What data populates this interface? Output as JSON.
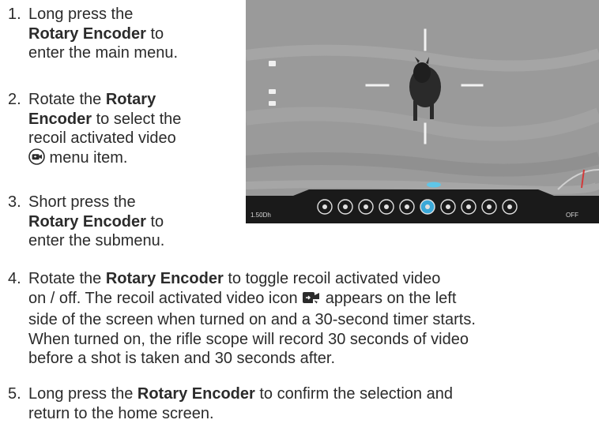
{
  "steps": [
    {
      "number": "1.",
      "lines": [
        {
          "parts": [
            "Long press the"
          ]
        },
        {
          "parts": [
            "",
            "Rotary Encoder",
            " to"
          ]
        },
        {
          "parts": [
            "enter the main menu."
          ]
        }
      ]
    },
    {
      "number": "2.",
      "lines": [
        {
          "parts": [
            "Rotate the ",
            "Rotary"
          ]
        },
        {
          "parts": [
            "",
            "Encoder",
            " to select the"
          ]
        },
        {
          "parts": [
            "recoil activated video"
          ]
        },
        {
          "parts": [
            " menu item."
          ]
        }
      ]
    },
    {
      "number": "3.",
      "lines": [
        {
          "parts": [
            "Short press the"
          ]
        },
        {
          "parts": [
            "",
            "Rotary Encoder",
            " to"
          ]
        },
        {
          "parts": [
            "enter the submenu."
          ]
        }
      ]
    },
    {
      "number": "4.",
      "lines": [
        {
          "parts": [
            "Rotate the ",
            "Rotary Encoder",
            " to toggle recoil activated video"
          ]
        },
        {
          "parts": [
            "on / off. The recoil activated video icon ",
            "",
            " appears on the left"
          ]
        },
        {
          "parts": [
            "side of the screen when turned on and a 30-second timer starts."
          ]
        },
        {
          "parts": [
            "When turned on, the rifle scope will record 30 seconds of video"
          ]
        },
        {
          "parts": [
            "before a shot is taken and 30 seconds after."
          ]
        }
      ]
    },
    {
      "number": "5.",
      "lines": [
        {
          "parts": [
            "Long press the ",
            "Rotary Encoder",
            " to confirm the selection and"
          ]
        },
        {
          "parts": [
            "return to the home screen."
          ]
        }
      ]
    }
  ],
  "icons": {
    "menu_icon": "recoil-video-menu-icon",
    "screen_icon": "recoil-video-screen-icon"
  },
  "scope_screen": {
    "bottom_left_label": "1.50Dh",
    "bottom_right_label": "OFF",
    "menu_icon_count": 10,
    "selected_menu_index": 5
  }
}
